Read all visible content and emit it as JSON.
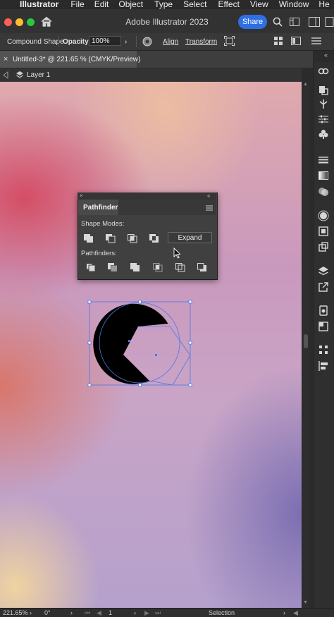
{
  "menubar": {
    "app_name": "Illustrator",
    "items": [
      "File",
      "Edit",
      "Object",
      "Type",
      "Select",
      "Effect",
      "View",
      "Window",
      "He"
    ]
  },
  "window": {
    "title": "Adobe Illustrator 2023",
    "share_label": "Share"
  },
  "control_bar": {
    "selection_type": "Compound Shape",
    "opacity_label": "Opacity:",
    "opacity_value": "100%",
    "align_label": "Align",
    "transform_label": "Transform"
  },
  "document": {
    "tab_label": "Untitled-3* @ 221.65 % (CMYK/Preview)",
    "layer_name": "Layer 1"
  },
  "pathfinder": {
    "title": "Pathfinder",
    "shape_modes_label": "Shape Modes:",
    "expand_label": "Expand",
    "pathfinders_label": "Pathfinders:",
    "shape_mode_icons": [
      "unite-icon",
      "minus-front-icon",
      "intersect-icon",
      "exclude-icon"
    ],
    "pathfinder_icons": [
      "divide-icon",
      "trim-icon",
      "merge-icon",
      "crop-icon",
      "outline-icon",
      "minus-back-icon"
    ]
  },
  "status_bar": {
    "zoom": "221.65%",
    "rotation": "0°",
    "artboard": "1",
    "tool": "Selection"
  },
  "colors": {
    "accent": "#2f6fe4",
    "selection": "#4a78e6"
  }
}
